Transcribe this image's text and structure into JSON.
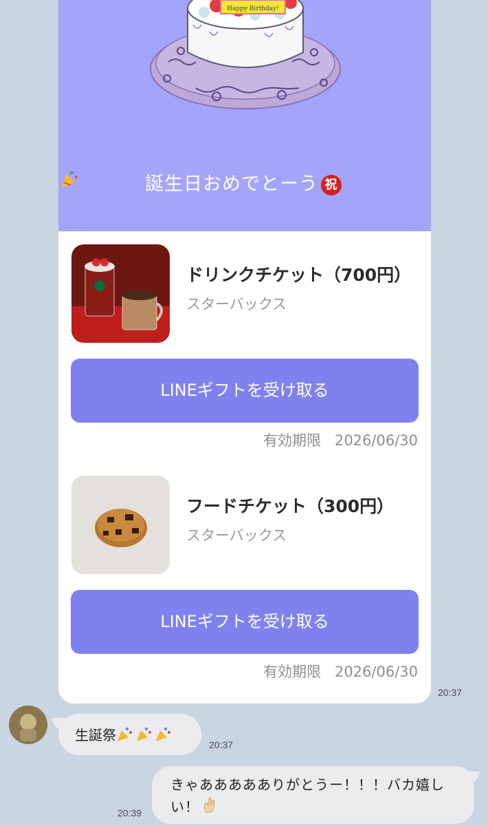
{
  "hero": {
    "cake_text": "Happy Birthday!",
    "message": "誕生日おめでとーう",
    "emoji_iwai": "祝"
  },
  "items": [
    {
      "name": "ドリンクチケット（700円）",
      "brand": "スターバックス",
      "button": "LINEギフトを受け取る",
      "expiry_label": "有効期限",
      "expiry_date": "2026/06/30"
    },
    {
      "name": "フードチケット（300円）",
      "brand": "スターバックス",
      "button": "LINEギフトを受け取る",
      "expiry_label": "有効期限",
      "expiry_date": "2026/06/30"
    }
  ],
  "card_time": "20:37",
  "messages": [
    {
      "direction": "incoming",
      "text": "生誕祭",
      "time": "20:37"
    },
    {
      "direction": "outgoing",
      "text_line1": "きゃああああありがとうー！！！バカ嬉し",
      "text_line2": "い！",
      "time": "20:39"
    }
  ],
  "colors": {
    "background": "#c9d6e1",
    "hero": "#a3a5fb",
    "button": "#7f82ee",
    "bubble": "#ececef"
  }
}
